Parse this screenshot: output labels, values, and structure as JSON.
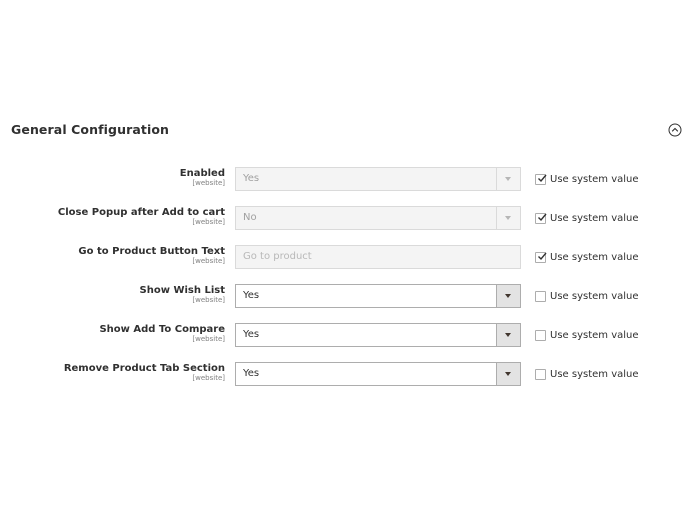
{
  "section": {
    "title": "General Configuration",
    "toggle_icon": "chevron-up-circle-icon"
  },
  "fields": [
    {
      "label": "Enabled",
      "scope": "[website]",
      "type": "select",
      "value": "Yes",
      "disabled": true,
      "use_system_value": true,
      "system_label": "Use system value"
    },
    {
      "label": "Close Popup after Add to cart",
      "scope": "[website]",
      "type": "select",
      "value": "No",
      "disabled": true,
      "use_system_value": true,
      "system_label": "Use system value"
    },
    {
      "label": "Go to Product Button Text",
      "scope": "[website]",
      "type": "text",
      "placeholder": "Go to product",
      "value": "",
      "disabled": true,
      "use_system_value": true,
      "system_label": "Use system value"
    },
    {
      "label": "Show Wish List",
      "scope": "[website]",
      "type": "select",
      "value": "Yes",
      "disabled": false,
      "use_system_value": false,
      "system_label": "Use system value"
    },
    {
      "label": "Show Add To Compare",
      "scope": "[website]",
      "type": "select",
      "value": "Yes",
      "disabled": false,
      "use_system_value": false,
      "system_label": "Use system value"
    },
    {
      "label": "Remove Product Tab Section",
      "scope": "[website]",
      "type": "select",
      "value": "Yes",
      "disabled": false,
      "use_system_value": false,
      "system_label": "Use system value"
    }
  ]
}
